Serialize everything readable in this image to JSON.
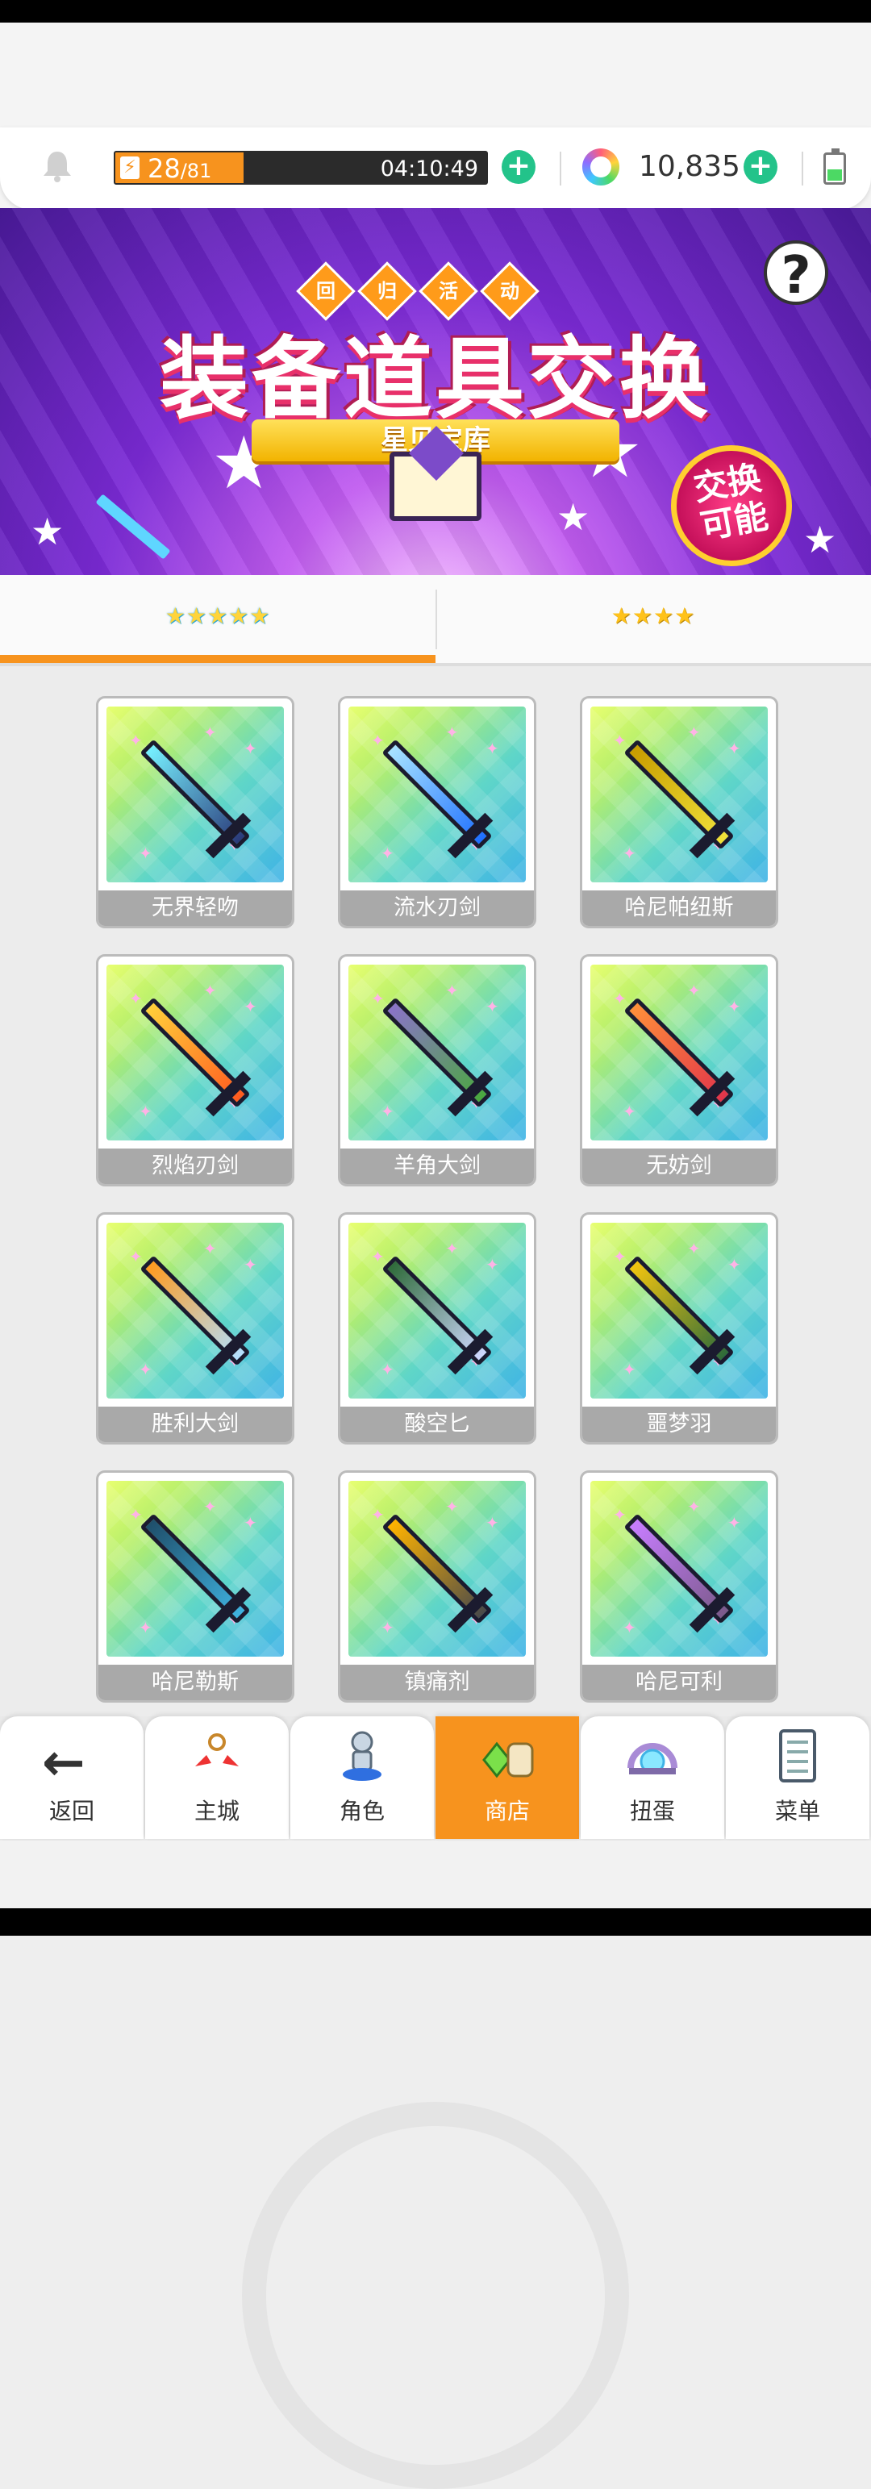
{
  "status": {
    "energy_current": "28",
    "energy_max": "/81",
    "energy_fraction": 0.345,
    "energy_timer": "04:10:49",
    "gems": "10,835"
  },
  "banner": {
    "badge_chars": [
      "回",
      "归",
      "活",
      "动"
    ],
    "title": "装备道具交换",
    "ribbon": "星见宝库",
    "stamp": "交换\n可能",
    "help": "?"
  },
  "tabs": [
    {
      "label": "★★★★★",
      "active": true
    },
    {
      "label": "★★★★",
      "active": false
    }
  ],
  "items": [
    {
      "name": "无界轻吻",
      "blade": "#2a3a7a",
      "accent": "#76f0ff"
    },
    {
      "name": "流水刃剑",
      "blade": "#1e6fff",
      "accent": "#a8e3ff"
    },
    {
      "name": "哈尼帕纽斯",
      "blade": "#f1e23a",
      "accent": "#c79c00"
    },
    {
      "name": "烈焰刃剑",
      "blade": "#ff5a1f",
      "accent": "#ffcf3a"
    },
    {
      "name": "羊角大剑",
      "blade": "#4aa83e",
      "accent": "#8b73c9"
    },
    {
      "name": "无妨剑",
      "blade": "#e0344a",
      "accent": "#ff8f3a"
    },
    {
      "name": "胜利大剑",
      "blade": "#b3e0ff",
      "accent": "#ff9a1f"
    },
    {
      "name": "酸空匕",
      "blade": "#cfd8ff",
      "accent": "#2f6b3a"
    },
    {
      "name": "噩梦羽",
      "blade": "#2e6b3a",
      "accent": "#f1c40f"
    },
    {
      "name": "哈尼勒斯",
      "blade": "#3fb2e0",
      "accent": "#1f4f6b"
    },
    {
      "name": "镇痛剂",
      "blade": "#4a4a4a",
      "accent": "#ffb300"
    },
    {
      "name": "哈尼可利",
      "blade": "#7b5a8a",
      "accent": "#c77dff"
    }
  ],
  "nav": [
    {
      "label": "返回",
      "icon": "back-arrow-icon",
      "active": false
    },
    {
      "label": "主城",
      "icon": "castle-icon",
      "active": false
    },
    {
      "label": "角色",
      "icon": "character-icon",
      "active": false
    },
    {
      "label": "商店",
      "icon": "shop-icon",
      "active": true
    },
    {
      "label": "扭蛋",
      "icon": "gacha-icon",
      "active": false
    },
    {
      "label": "菜单",
      "icon": "menu-icon",
      "active": false
    }
  ],
  "colors": {
    "accent": "#f7931e",
    "plus": "#23c38a",
    "label_bg": "#a9a9a9"
  }
}
